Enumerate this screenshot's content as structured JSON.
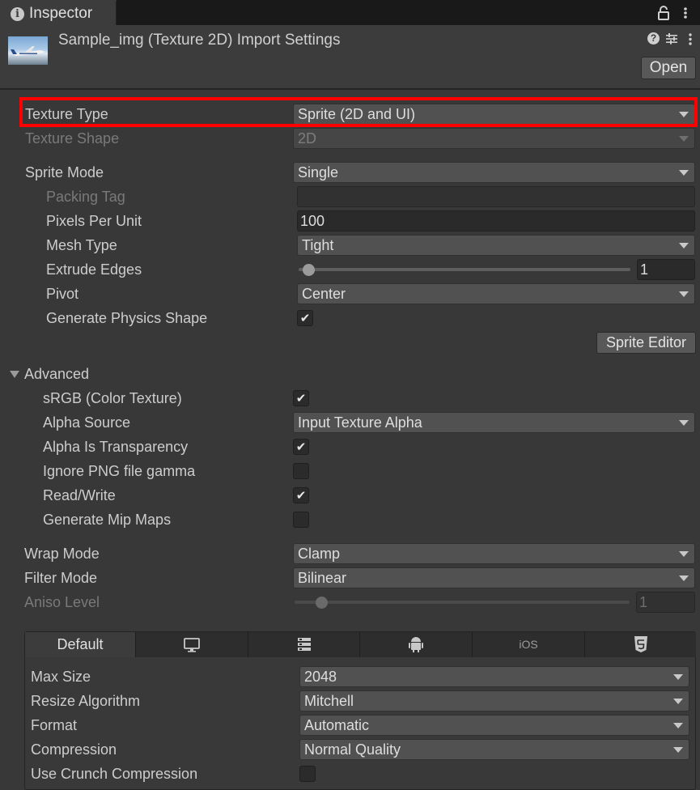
{
  "window": {
    "tab_title": "Inspector",
    "header_title": "Sample_img (Texture 2D) Import Settings",
    "open_button": "Open"
  },
  "fields": {
    "texture_type": {
      "label": "Texture Type",
      "value": "Sprite (2D and UI)"
    },
    "texture_shape": {
      "label": "Texture Shape",
      "value": "2D"
    },
    "sprite_mode": {
      "label": "Sprite Mode",
      "value": "Single"
    },
    "packing_tag": {
      "label": "Packing Tag",
      "value": ""
    },
    "pixels_per_unit": {
      "label": "Pixels Per Unit",
      "value": "100"
    },
    "mesh_type": {
      "label": "Mesh Type",
      "value": "Tight"
    },
    "extrude_edges": {
      "label": "Extrude Edges",
      "value": "1",
      "slider_fraction": 0.03
    },
    "pivot": {
      "label": "Pivot",
      "value": "Center"
    },
    "generate_physics_shape": {
      "label": "Generate Physics Shape",
      "checked": true
    },
    "sprite_editor_button": "Sprite Editor"
  },
  "advanced": {
    "label": "Advanced",
    "expanded": true,
    "srgb": {
      "label": "sRGB (Color Texture)",
      "checked": true
    },
    "alpha_source": {
      "label": "Alpha Source",
      "value": "Input Texture Alpha"
    },
    "alpha_is_transparency": {
      "label": "Alpha Is Transparency",
      "checked": true
    },
    "ignore_png_gamma": {
      "label": "Ignore PNG file gamma",
      "checked": false
    },
    "read_write": {
      "label": "Read/Write",
      "checked": true
    },
    "generate_mip_maps": {
      "label": "Generate Mip Maps",
      "checked": false
    }
  },
  "sampling": {
    "wrap_mode": {
      "label": "Wrap Mode",
      "value": "Clamp"
    },
    "filter_mode": {
      "label": "Filter Mode",
      "value": "Bilinear"
    },
    "aniso_level": {
      "label": "Aniso Level",
      "value": "1",
      "slider_fraction": 0.08
    }
  },
  "platform": {
    "tabs": [
      {
        "label": "Default",
        "icon": ""
      },
      {
        "label": "",
        "icon": "monitor-icon"
      },
      {
        "label": "",
        "icon": "server-icon"
      },
      {
        "label": "",
        "icon": "android-icon"
      },
      {
        "label": "iOS",
        "icon": ""
      },
      {
        "label": "",
        "icon": "html5-icon"
      }
    ],
    "active_tab": "Default",
    "max_size": {
      "label": "Max Size",
      "value": "2048"
    },
    "resize_algorithm": {
      "label": "Resize Algorithm",
      "value": "Mitchell"
    },
    "format": {
      "label": "Format",
      "value": "Automatic"
    },
    "compression": {
      "label": "Compression",
      "value": "Normal Quality"
    },
    "use_crunch": {
      "label": "Use Crunch Compression",
      "checked": false
    }
  },
  "colors": {
    "highlight": "#ff0000",
    "panel_bg": "#383838",
    "field_bg": "#515151"
  }
}
